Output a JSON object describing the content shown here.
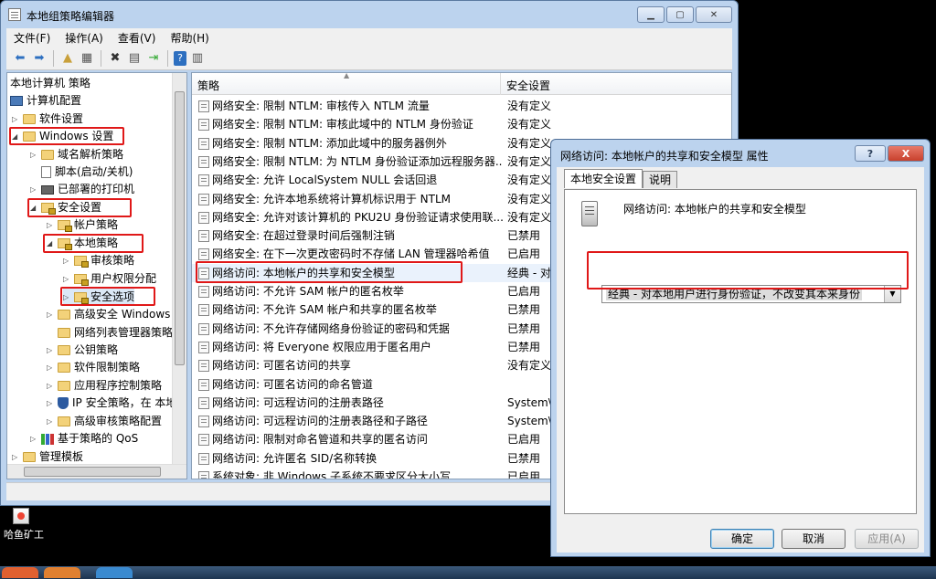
{
  "main_window": {
    "title": "本地组策略编辑器",
    "menu": [
      "文件(F)",
      "操作(A)",
      "查看(V)",
      "帮助(H)"
    ],
    "toolbar_icons": [
      "back-arrow-icon",
      "forward-arrow-icon",
      "up-folder-icon",
      "show-hide-tree-icon",
      "delete-icon",
      "properties-icon",
      "export-list-icon",
      "help-icon",
      "view-icon"
    ]
  },
  "tree": {
    "items": [
      {
        "label": "本地计算机 策略",
        "icon": "none"
      },
      {
        "label": "计算机配置",
        "icon": "pc"
      },
      {
        "label": "软件设置",
        "icon": "folder"
      },
      {
        "label": "Windows 设置",
        "icon": "folder"
      },
      {
        "label": "域名解析策略",
        "icon": "folder"
      },
      {
        "label": "脚本(启动/关机)",
        "icon": "doc"
      },
      {
        "label": "已部署的打印机",
        "icon": "printer"
      },
      {
        "label": "安全设置",
        "icon": "lockfolder"
      },
      {
        "label": "帐户策略",
        "icon": "lockfolder"
      },
      {
        "label": "本地策略",
        "icon": "lockfolder"
      },
      {
        "label": "审核策略",
        "icon": "lockfolder"
      },
      {
        "label": "用户权限分配",
        "icon": "lockfolder"
      },
      {
        "label": "安全选项",
        "icon": "lockfolder"
      },
      {
        "label": "高级安全 Windows",
        "icon": "folder"
      },
      {
        "label": "网络列表管理器策略",
        "icon": "folder"
      },
      {
        "label": "公钥策略",
        "icon": "folder"
      },
      {
        "label": "软件限制策略",
        "icon": "folder"
      },
      {
        "label": "应用程序控制策略",
        "icon": "folder"
      },
      {
        "label": "IP 安全策略，在 本地",
        "icon": "shield"
      },
      {
        "label": "高级审核策略配置",
        "icon": "folder"
      },
      {
        "label": "基于策略的 QoS",
        "icon": "chart"
      },
      {
        "label": "管理模板",
        "icon": "folder"
      }
    ]
  },
  "list": {
    "headers": [
      "策略",
      "安全设置"
    ],
    "rows": [
      {
        "policy": "网络安全: 限制 NTLM: 审核传入 NTLM 流量",
        "setting": "没有定义"
      },
      {
        "policy": "网络安全: 限制 NTLM: 审核此域中的 NTLM 身份验证",
        "setting": "没有定义"
      },
      {
        "policy": "网络安全: 限制 NTLM: 添加此域中的服务器例外",
        "setting": "没有定义"
      },
      {
        "policy": "网络安全: 限制 NTLM: 为 NTLM 身份验证添加远程服务器...",
        "setting": "没有定义"
      },
      {
        "policy": "网络安全: 允许 LocalSystem NULL 会话回退",
        "setting": "没有定义"
      },
      {
        "policy": "网络安全: 允许本地系统将计算机标识用于 NTLM",
        "setting": "没有定义"
      },
      {
        "policy": "网络安全: 允许对该计算机的 PKU2U 身份验证请求使用联...",
        "setting": "没有定义"
      },
      {
        "policy": "网络安全: 在超过登录时间后强制注销",
        "setting": "已禁用"
      },
      {
        "policy": "网络安全: 在下一次更改密码时不存储 LAN 管理器哈希值",
        "setting": "已启用"
      },
      {
        "policy": "网络访问: 本地帐户的共享和安全模型",
        "setting": "经典 - 对"
      },
      {
        "policy": "网络访问: 不允许 SAM 帐户的匿名枚举",
        "setting": "已启用"
      },
      {
        "policy": "网络访问: 不允许 SAM 帐户和共享的匿名枚举",
        "setting": "已禁用"
      },
      {
        "policy": "网络访问: 不允许存储网络身份验证的密码和凭据",
        "setting": "已禁用"
      },
      {
        "policy": "网络访问: 将 Everyone 权限应用于匿名用户",
        "setting": "已禁用"
      },
      {
        "policy": "网络访问: 可匿名访问的共享",
        "setting": "没有定义"
      },
      {
        "policy": "网络访问: 可匿名访问的命名管道",
        "setting": ""
      },
      {
        "policy": "网络访问: 可远程访问的注册表路径",
        "setting": "System\\C"
      },
      {
        "policy": "网络访问: 可远程访问的注册表路径和子路径",
        "setting": "System\\C"
      },
      {
        "policy": "网络访问: 限制对命名管道和共享的匿名访问",
        "setting": "已启用"
      },
      {
        "policy": "网络访问: 允许匿名 SID/名称转换",
        "setting": "已禁用"
      },
      {
        "policy": "系统对象: 非 Windows 子系统不要求区分大小写",
        "setting": "已启用"
      }
    ]
  },
  "dialog": {
    "title": "网络访问: 本地帐户的共享和安全模型 属性",
    "help_label": "?",
    "close_label": "X",
    "tabs": [
      "本地安全设置",
      "说明"
    ],
    "policy_name": "网络访问: 本地帐户的共享和安全模型",
    "combo_value": "经典 - 对本地用户进行身份验证，不改变其本来身份",
    "ok_label": "确定",
    "cancel_label": "取消",
    "apply_label": "应用(A)"
  },
  "desktop": {
    "icon_label": "哈鱼矿工"
  },
  "colors": {
    "annotation_red": "#e01818",
    "title_bar": "#bcd3ee"
  }
}
